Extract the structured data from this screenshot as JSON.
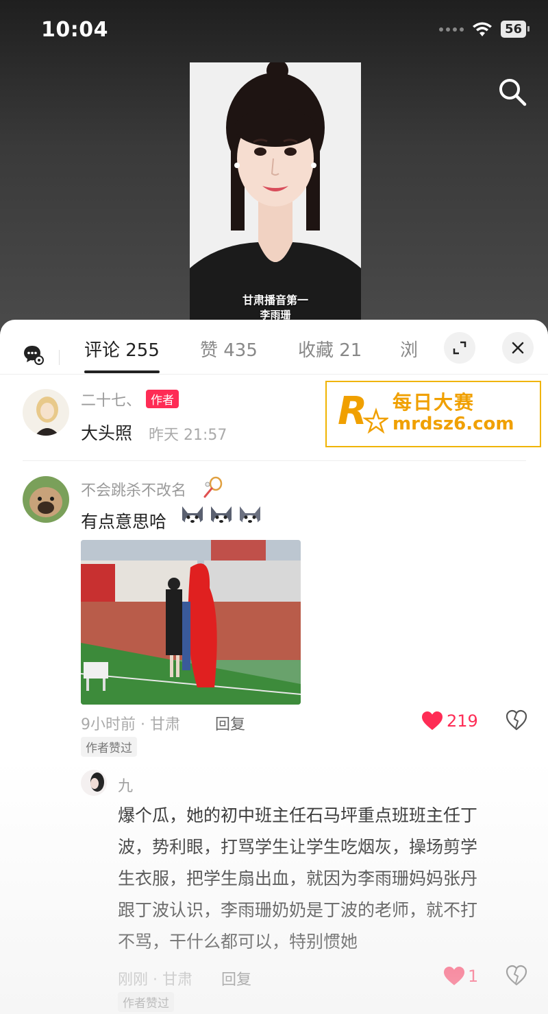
{
  "status_bar": {
    "time": "10:04",
    "battery": "56"
  },
  "video": {
    "caption_line1": "甘肃播音第一",
    "caption_line2": "李雨珊"
  },
  "tabs": [
    {
      "label": "评论 255",
      "active": true
    },
    {
      "label": "赞 435",
      "active": false
    },
    {
      "label": "收藏 21",
      "active": false
    },
    {
      "label": "浏",
      "active": false
    }
  ],
  "watermark": {
    "cn": "每日大赛",
    "url": "mrdsz6.com",
    "logo": "R"
  },
  "comments": [
    {
      "user": "二十七、",
      "tag": "作者",
      "text": "大头照",
      "time": "昨天 21:57"
    },
    {
      "user": "不会跳杀不改名",
      "text": "有点意思哈",
      "time": "9小时前 · 甘肃",
      "reply_label": "回复",
      "liked_by_author": "作者赞过",
      "likes": "219"
    }
  ],
  "reply": {
    "user": "九",
    "lines": [
      "爆个瓜，她的初中班主任石马坪重点班班主任丁",
      "波，势利眼，打骂学生让学生吃烟灰，操场剪学",
      "生衣服，把学生扇出血，就因为李雨珊妈妈张丹",
      "跟丁波认识，李雨珊奶奶是丁波的老师，就不打",
      "不骂，干什么都可以，特别惯她"
    ],
    "time": "刚刚 · 甘肃",
    "reply_label": "回复",
    "liked_by_author": "作者赞过",
    "likes": "1"
  },
  "colors": {
    "accent": "#fe2c55",
    "watermark": "#f0a000"
  }
}
